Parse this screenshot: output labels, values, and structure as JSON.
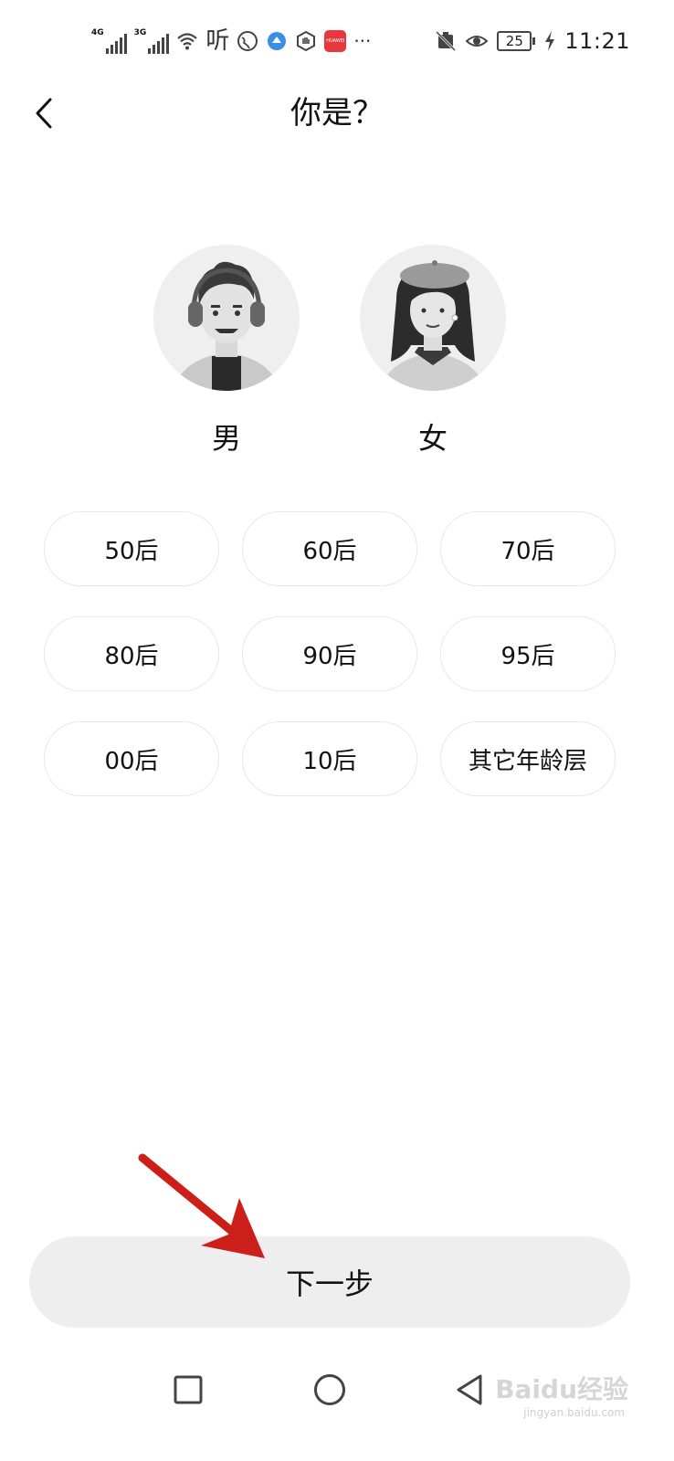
{
  "status_bar": {
    "network1": "4G",
    "network2": "3G",
    "listen_text": "听",
    "more": "···",
    "app_badge": "HUAWEI",
    "battery": "25",
    "time": "11:21",
    "icons": [
      "signal-icon",
      "signal-icon",
      "wifi-icon",
      "listen-icon",
      "browser-icon",
      "app-icon",
      "hand-icon",
      "huawei-app-icon",
      "more-icon",
      "no-sim-icon",
      "eye-icon",
      "battery-icon",
      "charging-icon"
    ]
  },
  "header": {
    "title": "你是？",
    "back_icon": "chevron-left-icon"
  },
  "gender": {
    "male": "男",
    "female": "女"
  },
  "age_options": [
    "50后",
    "60后",
    "70后",
    "80后",
    "90后",
    "95后",
    "00后",
    "10后",
    "其它年龄层"
  ],
  "next_button": "下一步",
  "annotation": {
    "arrow_color": "#cc1f1a"
  },
  "nav": {
    "recent_icon": "square-icon",
    "home_icon": "circle-icon",
    "back_icon": "triangle-back-icon"
  },
  "watermark": {
    "brand": "Baidu经验",
    "url": "jingyan.baidu.com"
  }
}
